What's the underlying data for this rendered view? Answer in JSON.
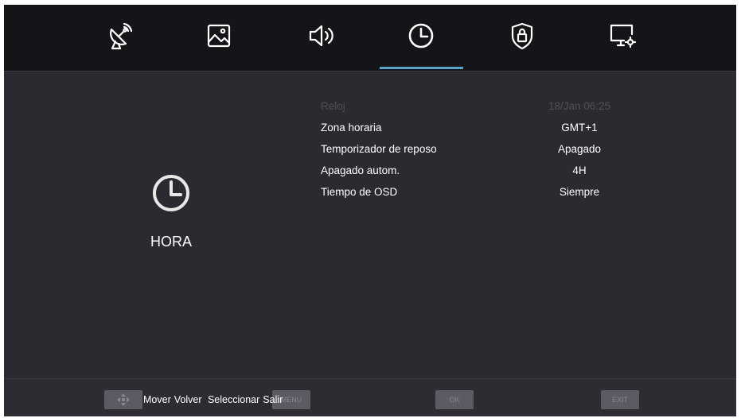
{
  "tabs": [
    {
      "icon": "satellite-dish-icon"
    },
    {
      "icon": "picture-icon"
    },
    {
      "icon": "speaker-icon"
    },
    {
      "icon": "clock-icon",
      "active": true
    },
    {
      "icon": "lock-shield-icon"
    },
    {
      "icon": "monitor-settings-icon"
    }
  ],
  "section": {
    "title": "HORA",
    "icon": "clock-icon"
  },
  "settings": [
    {
      "label": "Reloj",
      "value": "18/Jan  06:25",
      "disabled": true
    },
    {
      "label": "Zona horaria",
      "value": "GMT+1"
    },
    {
      "label": "Temporizador de reposo",
      "value": "Apagado"
    },
    {
      "label": "Apagado autom.",
      "value": "4H"
    },
    {
      "label": "Tiempo de OSD",
      "value": "Siempre"
    }
  ],
  "footer": {
    "move": "Mover",
    "back": "Volver",
    "select": "Seleccionar",
    "exit": "Salir",
    "keys": {
      "menu": "MENU",
      "ok": "OK",
      "exit": "EXIT"
    }
  },
  "colors": {
    "accent": "#58a3c6",
    "background": "#2a2b31",
    "topbar": "#141519"
  }
}
